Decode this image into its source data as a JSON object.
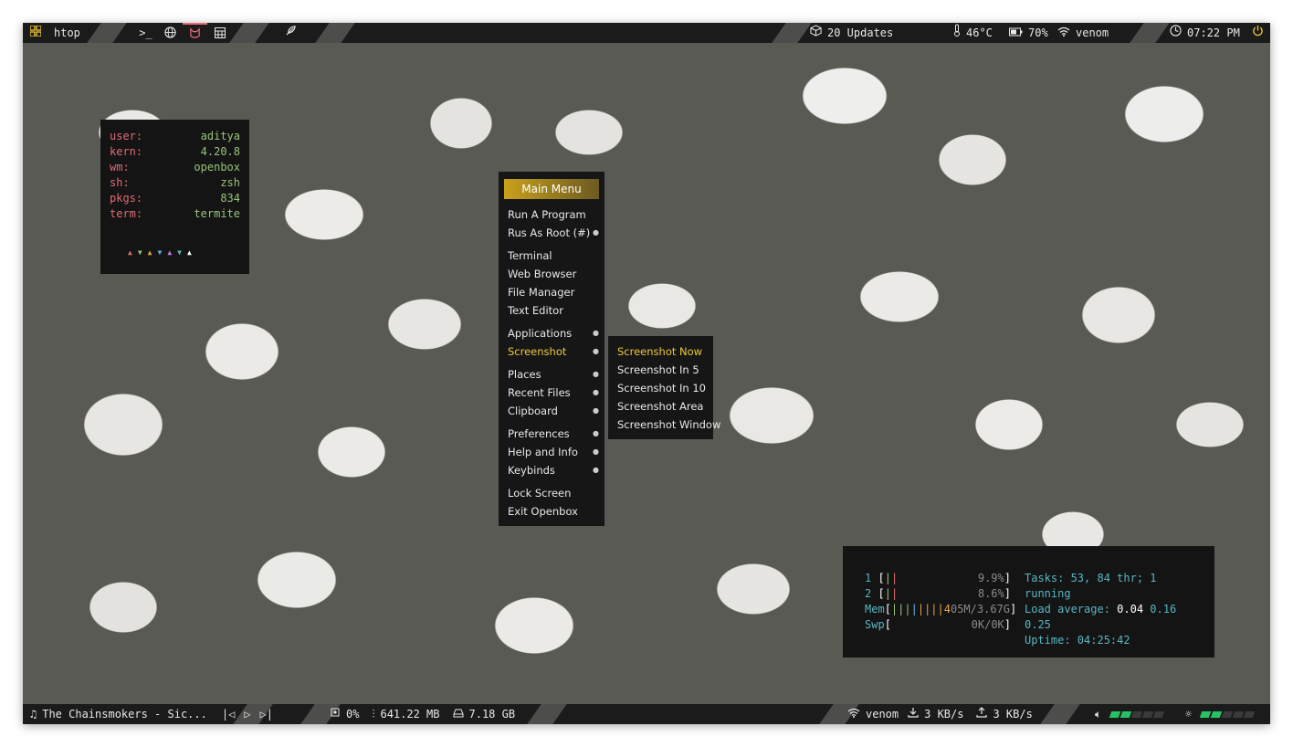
{
  "top_bar": {
    "app_title": "htop",
    "updates": "20 Updates",
    "temperature": "46°C",
    "battery": "70%",
    "wifi": "venom",
    "clock": "07:22 PM",
    "icons": [
      "grid-icon",
      "terminal-icon",
      "globe-icon",
      "cat-icon",
      "calculator-icon",
      "feather-icon",
      "package-icon",
      "thermometer-icon",
      "battery-icon",
      "wifi-icon",
      "clock-icon",
      "power-icon"
    ]
  },
  "fetch": {
    "rows": [
      {
        "key": "user:",
        "value": "aditya"
      },
      {
        "key": "kern:",
        "value": "4.20.8"
      },
      {
        "key": "wm:",
        "value": "openbox"
      },
      {
        "key": "sh:",
        "value": "zsh"
      },
      {
        "key": "pkgs:",
        "value": "834"
      },
      {
        "key": "term:",
        "value": "termite"
      }
    ],
    "colors": [
      "#e06b74",
      "#98c379",
      "#e5a24b",
      "#61afef",
      "#c678dd",
      "#56b6c2",
      "#ffffff"
    ]
  },
  "menu": {
    "title": "Main Menu",
    "items": [
      {
        "label": "Run A Program",
        "sub": false
      },
      {
        "label": "Rus As Root (#)",
        "sub": true
      },
      {
        "label": "Terminal",
        "sub": false
      },
      {
        "label": "Web Browser",
        "sub": false
      },
      {
        "label": "File Manager",
        "sub": false
      },
      {
        "label": "Text Editor",
        "sub": false
      },
      {
        "label": "Applications",
        "sub": true
      },
      {
        "label": "Screenshot",
        "sub": true
      },
      {
        "label": "Places",
        "sub": true
      },
      {
        "label": "Recent Files",
        "sub": true
      },
      {
        "label": "Clipboard",
        "sub": true
      },
      {
        "label": "Preferences",
        "sub": true
      },
      {
        "label": "Help and Info",
        "sub": true
      },
      {
        "label": "Keybinds",
        "sub": true
      },
      {
        "label": "Lock Screen",
        "sub": false
      },
      {
        "label": "Exit Openbox",
        "sub": false
      }
    ],
    "submenu": [
      "Screenshot Now",
      "Screenshot In 5",
      "Screenshot In 10",
      "Screenshot Area",
      "Screenshot Window"
    ]
  },
  "htop": {
    "cpu1_label": "1",
    "cpu1_value": "9.9%",
    "cpu2_label": "2",
    "cpu2_value": "8.6%",
    "mem_label": "Mem",
    "mem_value_prefix": "4",
    "mem_value": "05M/3.67G",
    "swp_label": "Swp",
    "swp_value": "0K/0K",
    "tasks": "Tasks: 53, 84 thr; 1 running",
    "load_label": "Load average:",
    "load1": "0.04",
    "load5": "0.16",
    "load15": "0.25",
    "uptime": "Uptime: 04:25:42"
  },
  "bottom_bar": {
    "song": "The Chainsmokers - Sic...",
    "cpu": "0%",
    "memory": "641.22 MB",
    "disk": "7.18 GB",
    "wifi": "venom",
    "download": "3 KB/s",
    "upload": "3 KB/s",
    "volume_level": 0.4,
    "brightness_level": 0.4
  }
}
